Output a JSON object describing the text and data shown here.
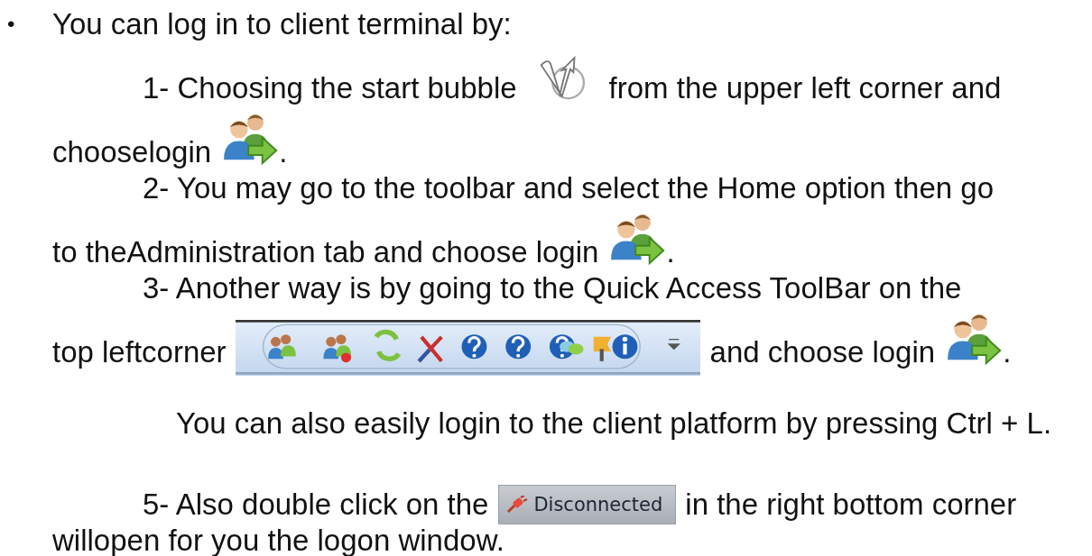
{
  "items": [
    {
      "kind": "bullet",
      "bullet": "•",
      "lines": [
        [
          {
            "kind": "text",
            "text": "You can log in to client terminal by:"
          }
        ]
      ]
    },
    {
      "kind": "step",
      "lines": [
        [
          {
            "kind": "text",
            "text": "1- Choosing the start bubble"
          },
          {
            "kind": "bubble"
          },
          {
            "kind": "text",
            "text": "from the upper left corner and"
          }
        ],
        [
          {
            "kind": "text",
            "text": "chooselogin"
          },
          {
            "kind": "login"
          },
          {
            "kind": "text",
            "text": "."
          }
        ]
      ]
    },
    {
      "kind": "step",
      "lines": [
        [
          {
            "kind": "text",
            "text": "2- You may go to the toolbar and select the Home option then go"
          }
        ],
        [
          {
            "kind": "text",
            "text": "to theAdministration tab and choose login"
          },
          {
            "kind": "login"
          },
          {
            "kind": "text",
            "text": "."
          }
        ]
      ]
    },
    {
      "kind": "step",
      "lines": [
        [
          {
            "kind": "text",
            "text": "3- Another way is by going to the Quick Access ToolBar on the"
          }
        ],
        [
          {
            "kind": "text",
            "text": "top leftcorner"
          },
          {
            "kind": "toolbar"
          },
          {
            "kind": "text",
            "text": "and choose login"
          },
          {
            "kind": "login"
          },
          {
            "kind": "text",
            "text": "."
          }
        ]
      ]
    },
    {
      "kind": "note",
      "lines": [
        [
          {
            "kind": "text",
            "text": "You can also easily login to the client platform by pressing Ctrl + L."
          }
        ]
      ]
    },
    {
      "kind": "step",
      "lines": [
        [
          {
            "kind": "text",
            "text": "5- Also double click on the"
          },
          {
            "kind": "status",
            "label": "Disconnected"
          },
          {
            "kind": "text",
            "text": "in the right bottom corner"
          }
        ],
        [
          {
            "kind": "text",
            "text": "willopen for you the logon window."
          }
        ]
      ]
    }
  ]
}
